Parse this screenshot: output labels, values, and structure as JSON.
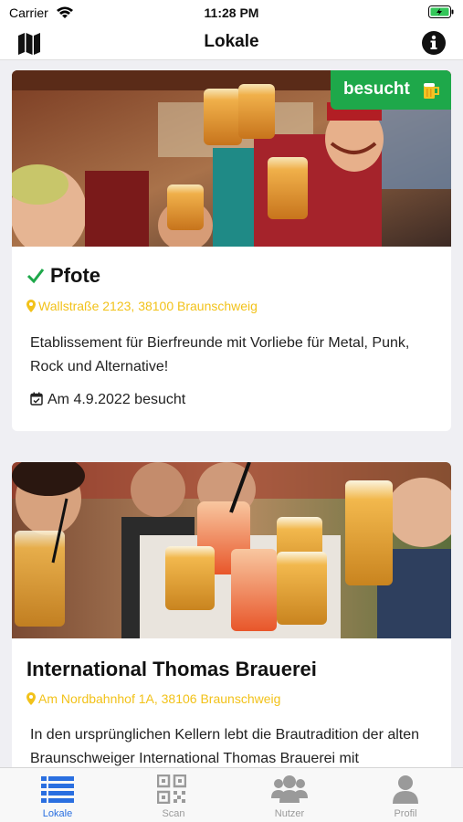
{
  "status_bar": {
    "carrier": "Carrier",
    "time": "11:28 PM"
  },
  "nav": {
    "title": "Lokale",
    "left_icon": "map-icon",
    "right_icon": "info-icon"
  },
  "colors": {
    "accent": "#1ea84a",
    "address": "#f2c21a",
    "tab_active": "#2a6fe0",
    "tab_inactive": "#9a9a9a"
  },
  "lokale": [
    {
      "name": "Pfote",
      "address": "Wallstraße 2123, 38100 Braunschweig",
      "description": "Etablissement für Bierfreunde mit Vorliebe für Metal, Punk, Rock und Alternative!",
      "visited": true,
      "badge": "besucht",
      "visited_text": "Am 4.9.2022 besucht"
    },
    {
      "name": "International Thomas Brauerei",
      "address": "Am Nordbahnhof 1A, 38106 Braunschweig",
      "description": "In den ursprünglichen Kellern lebt die Brautradition der alten Braunschweiger International Thomas Brauerei mit",
      "visited": false
    }
  ],
  "tabs": [
    {
      "label": "Lokale",
      "icon": "list-icon",
      "active": true
    },
    {
      "label": "Scan",
      "icon": "qr-code-icon",
      "active": false
    },
    {
      "label": "Nutzer",
      "icon": "users-icon",
      "active": false
    },
    {
      "label": "Profil",
      "icon": "user-icon",
      "active": false
    }
  ]
}
